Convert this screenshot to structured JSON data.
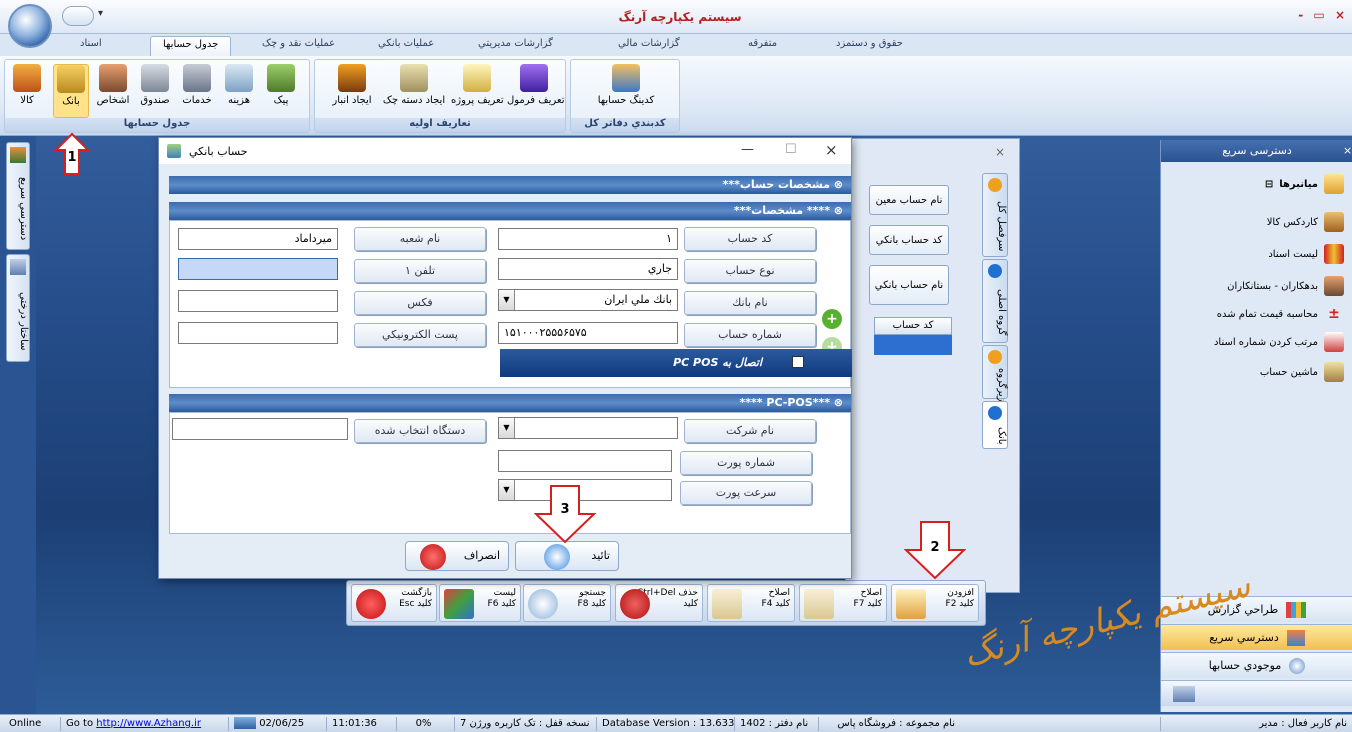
{
  "app": {
    "title": "سیستم یکپارچه آرنگ",
    "window_controls": "- ▭ ×"
  },
  "tabs": [
    "اسناد",
    "جدول حسابها",
    "عمليات نقد و چک",
    "عمليات بانكي",
    "گزارشات مديريتي",
    "گزارشات مالي",
    "متفرقه",
    "حقوق و دستمزد"
  ],
  "ribbon": {
    "group1": {
      "label": "جدول حسابها",
      "buttons": [
        "كالا",
        "بانک",
        "اشخاص",
        "صندوق",
        "خدمات",
        "هزينه",
        "پیک"
      ]
    },
    "group2": {
      "label": "تعاريف اوليه",
      "buttons": [
        "ایجاد انبار",
        "ایجاد دسته چک",
        "تعریف پروژه",
        "تعريف فرمول"
      ]
    },
    "group3": {
      "label": "كدبندي دفاتر كل",
      "buttons": [
        "كدينگ حسابها"
      ]
    }
  },
  "left_tabs": [
    "دسترسي سريع",
    "ساختار درختي"
  ],
  "quick_access": {
    "title": "دسترسی سريع",
    "section": "ميانبرها",
    "items": [
      "كاردكس كالا",
      "ليست اسناد",
      "بدهكاران - بستانكاران",
      "محاسبه قيمت تمام شده",
      "مرتب كردن شماره اسناد",
      "ماشين حساب"
    ],
    "bottom": [
      "طراحي گزارش",
      "دسترسي سريع",
      "موجودي حسابها"
    ]
  },
  "background_window": {
    "buttons": [
      "نام حساب معين",
      "كد حساب بانكي",
      "نام حساب بانكي"
    ],
    "column_header": "كد حساب",
    "side_tabs": [
      "سرفصل کل",
      "گروه اصلی",
      "زیرگروه",
      "بانک"
    ]
  },
  "toolbar": [
    {
      "label": "افزودن",
      "key": "كليد F2"
    },
    {
      "label": "اصلاح",
      "key": "كليد F7"
    },
    {
      "label": "اصلاح",
      "key": "كليد F4"
    },
    {
      "label": "حذف Ctrl+Del",
      "key": "كليد"
    },
    {
      "label": "جستجو",
      "key": "كليد F8"
    },
    {
      "label": "ليست",
      "key": "كليد F6"
    },
    {
      "label": "بازگشت",
      "key": "كليد Esc"
    }
  ],
  "dialog": {
    "title": "حساب بانكي",
    "sections": {
      "spec": "مشخصات حساب***",
      "sub": "**** مشخصات***",
      "pcpos": "***PC-POS ****"
    },
    "labels": {
      "account_code": "كد حساب",
      "account_type": "نوع حساب",
      "bank_name": "نام بانك",
      "account_number": "شماره حساب",
      "branch_name": "نام شعبه",
      "phone1": "تلفن ۱",
      "fax": "فكس",
      "email": "پست الكترونيكي",
      "company_name": "نام شركت",
      "port_number": "شماره پورت",
      "port_speed": "سرعت پورت",
      "device": "دستگاه انتخاب شده"
    },
    "values": {
      "account_code": "۱",
      "account_type": "جاري",
      "bank_name": "بانك ملي ايران",
      "account_number": "۱۵۱۰۰۰۲۵۵۵۶۵۷۵",
      "branch_name": "ميرداماد",
      "phone1": "",
      "fax": "",
      "email": ""
    },
    "pcpos_connect": "اتصال به PC POS",
    "confirm": "تائيد",
    "cancel": "انصراف"
  },
  "annotations": [
    "1",
    "2",
    "3"
  ],
  "status": {
    "online": "Online",
    "goto": "Go to",
    "url": "http://www.Azhang.ir",
    "date": "02/06/25",
    "time": "11:01:36",
    "percent": "0%",
    "version": "نسخه قفل : تک کاربره ورژن 7",
    "db": "Database Version : 13.633",
    "year": "نام دفتر : 1402",
    "company": "نام مجموعه : فروشگاه پاس",
    "user": "نام کاربر فعال : مدیر"
  },
  "logo_text": "سیستم یکپارچه آرنگ",
  "colors": {
    "accent": "#2c5aa0",
    "arrow": "#d62020",
    "title": "#b31e1e"
  }
}
